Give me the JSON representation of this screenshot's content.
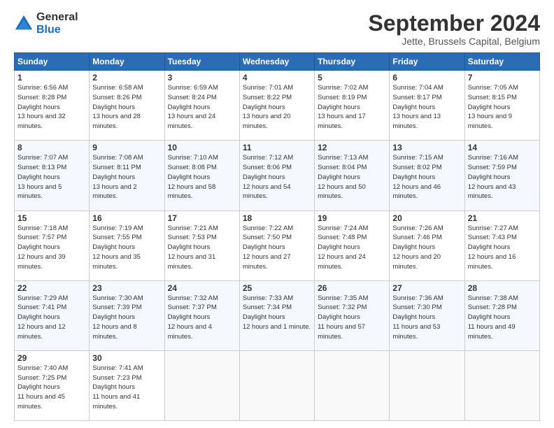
{
  "logo": {
    "general": "General",
    "blue": "Blue"
  },
  "title": "September 2024",
  "subtitle": "Jette, Brussels Capital, Belgium",
  "headers": [
    "Sunday",
    "Monday",
    "Tuesday",
    "Wednesday",
    "Thursday",
    "Friday",
    "Saturday"
  ],
  "weeks": [
    [
      {
        "day": "1",
        "sunrise": "6:56 AM",
        "sunset": "8:28 PM",
        "daylight": "13 hours and 32 minutes."
      },
      {
        "day": "2",
        "sunrise": "6:58 AM",
        "sunset": "8:26 PM",
        "daylight": "13 hours and 28 minutes."
      },
      {
        "day": "3",
        "sunrise": "6:59 AM",
        "sunset": "8:24 PM",
        "daylight": "13 hours and 24 minutes."
      },
      {
        "day": "4",
        "sunrise": "7:01 AM",
        "sunset": "8:22 PM",
        "daylight": "13 hours and 20 minutes."
      },
      {
        "day": "5",
        "sunrise": "7:02 AM",
        "sunset": "8:19 PM",
        "daylight": "13 hours and 17 minutes."
      },
      {
        "day": "6",
        "sunrise": "7:04 AM",
        "sunset": "8:17 PM",
        "daylight": "13 hours and 13 minutes."
      },
      {
        "day": "7",
        "sunrise": "7:05 AM",
        "sunset": "8:15 PM",
        "daylight": "13 hours and 9 minutes."
      }
    ],
    [
      {
        "day": "8",
        "sunrise": "7:07 AM",
        "sunset": "8:13 PM",
        "daylight": "13 hours and 5 minutes."
      },
      {
        "day": "9",
        "sunrise": "7:08 AM",
        "sunset": "8:11 PM",
        "daylight": "13 hours and 2 minutes."
      },
      {
        "day": "10",
        "sunrise": "7:10 AM",
        "sunset": "8:08 PM",
        "daylight": "12 hours and 58 minutes."
      },
      {
        "day": "11",
        "sunrise": "7:12 AM",
        "sunset": "8:06 PM",
        "daylight": "12 hours and 54 minutes."
      },
      {
        "day": "12",
        "sunrise": "7:13 AM",
        "sunset": "8:04 PM",
        "daylight": "12 hours and 50 minutes."
      },
      {
        "day": "13",
        "sunrise": "7:15 AM",
        "sunset": "8:02 PM",
        "daylight": "12 hours and 46 minutes."
      },
      {
        "day": "14",
        "sunrise": "7:16 AM",
        "sunset": "7:59 PM",
        "daylight": "12 hours and 43 minutes."
      }
    ],
    [
      {
        "day": "15",
        "sunrise": "7:18 AM",
        "sunset": "7:57 PM",
        "daylight": "12 hours and 39 minutes."
      },
      {
        "day": "16",
        "sunrise": "7:19 AM",
        "sunset": "7:55 PM",
        "daylight": "12 hours and 35 minutes."
      },
      {
        "day": "17",
        "sunrise": "7:21 AM",
        "sunset": "7:53 PM",
        "daylight": "12 hours and 31 minutes."
      },
      {
        "day": "18",
        "sunrise": "7:22 AM",
        "sunset": "7:50 PM",
        "daylight": "12 hours and 27 minutes."
      },
      {
        "day": "19",
        "sunrise": "7:24 AM",
        "sunset": "7:48 PM",
        "daylight": "12 hours and 24 minutes."
      },
      {
        "day": "20",
        "sunrise": "7:26 AM",
        "sunset": "7:46 PM",
        "daylight": "12 hours and 20 minutes."
      },
      {
        "day": "21",
        "sunrise": "7:27 AM",
        "sunset": "7:43 PM",
        "daylight": "12 hours and 16 minutes."
      }
    ],
    [
      {
        "day": "22",
        "sunrise": "7:29 AM",
        "sunset": "7:41 PM",
        "daylight": "12 hours and 12 minutes."
      },
      {
        "day": "23",
        "sunrise": "7:30 AM",
        "sunset": "7:39 PM",
        "daylight": "12 hours and 8 minutes."
      },
      {
        "day": "24",
        "sunrise": "7:32 AM",
        "sunset": "7:37 PM",
        "daylight": "12 hours and 4 minutes."
      },
      {
        "day": "25",
        "sunrise": "7:33 AM",
        "sunset": "7:34 PM",
        "daylight": "12 hours and 1 minute."
      },
      {
        "day": "26",
        "sunrise": "7:35 AM",
        "sunset": "7:32 PM",
        "daylight": "11 hours and 57 minutes."
      },
      {
        "day": "27",
        "sunrise": "7:36 AM",
        "sunset": "7:30 PM",
        "daylight": "11 hours and 53 minutes."
      },
      {
        "day": "28",
        "sunrise": "7:38 AM",
        "sunset": "7:28 PM",
        "daylight": "11 hours and 49 minutes."
      }
    ],
    [
      {
        "day": "29",
        "sunrise": "7:40 AM",
        "sunset": "7:25 PM",
        "daylight": "11 hours and 45 minutes."
      },
      {
        "day": "30",
        "sunrise": "7:41 AM",
        "sunset": "7:23 PM",
        "daylight": "11 hours and 41 minutes."
      },
      null,
      null,
      null,
      null,
      null
    ]
  ]
}
